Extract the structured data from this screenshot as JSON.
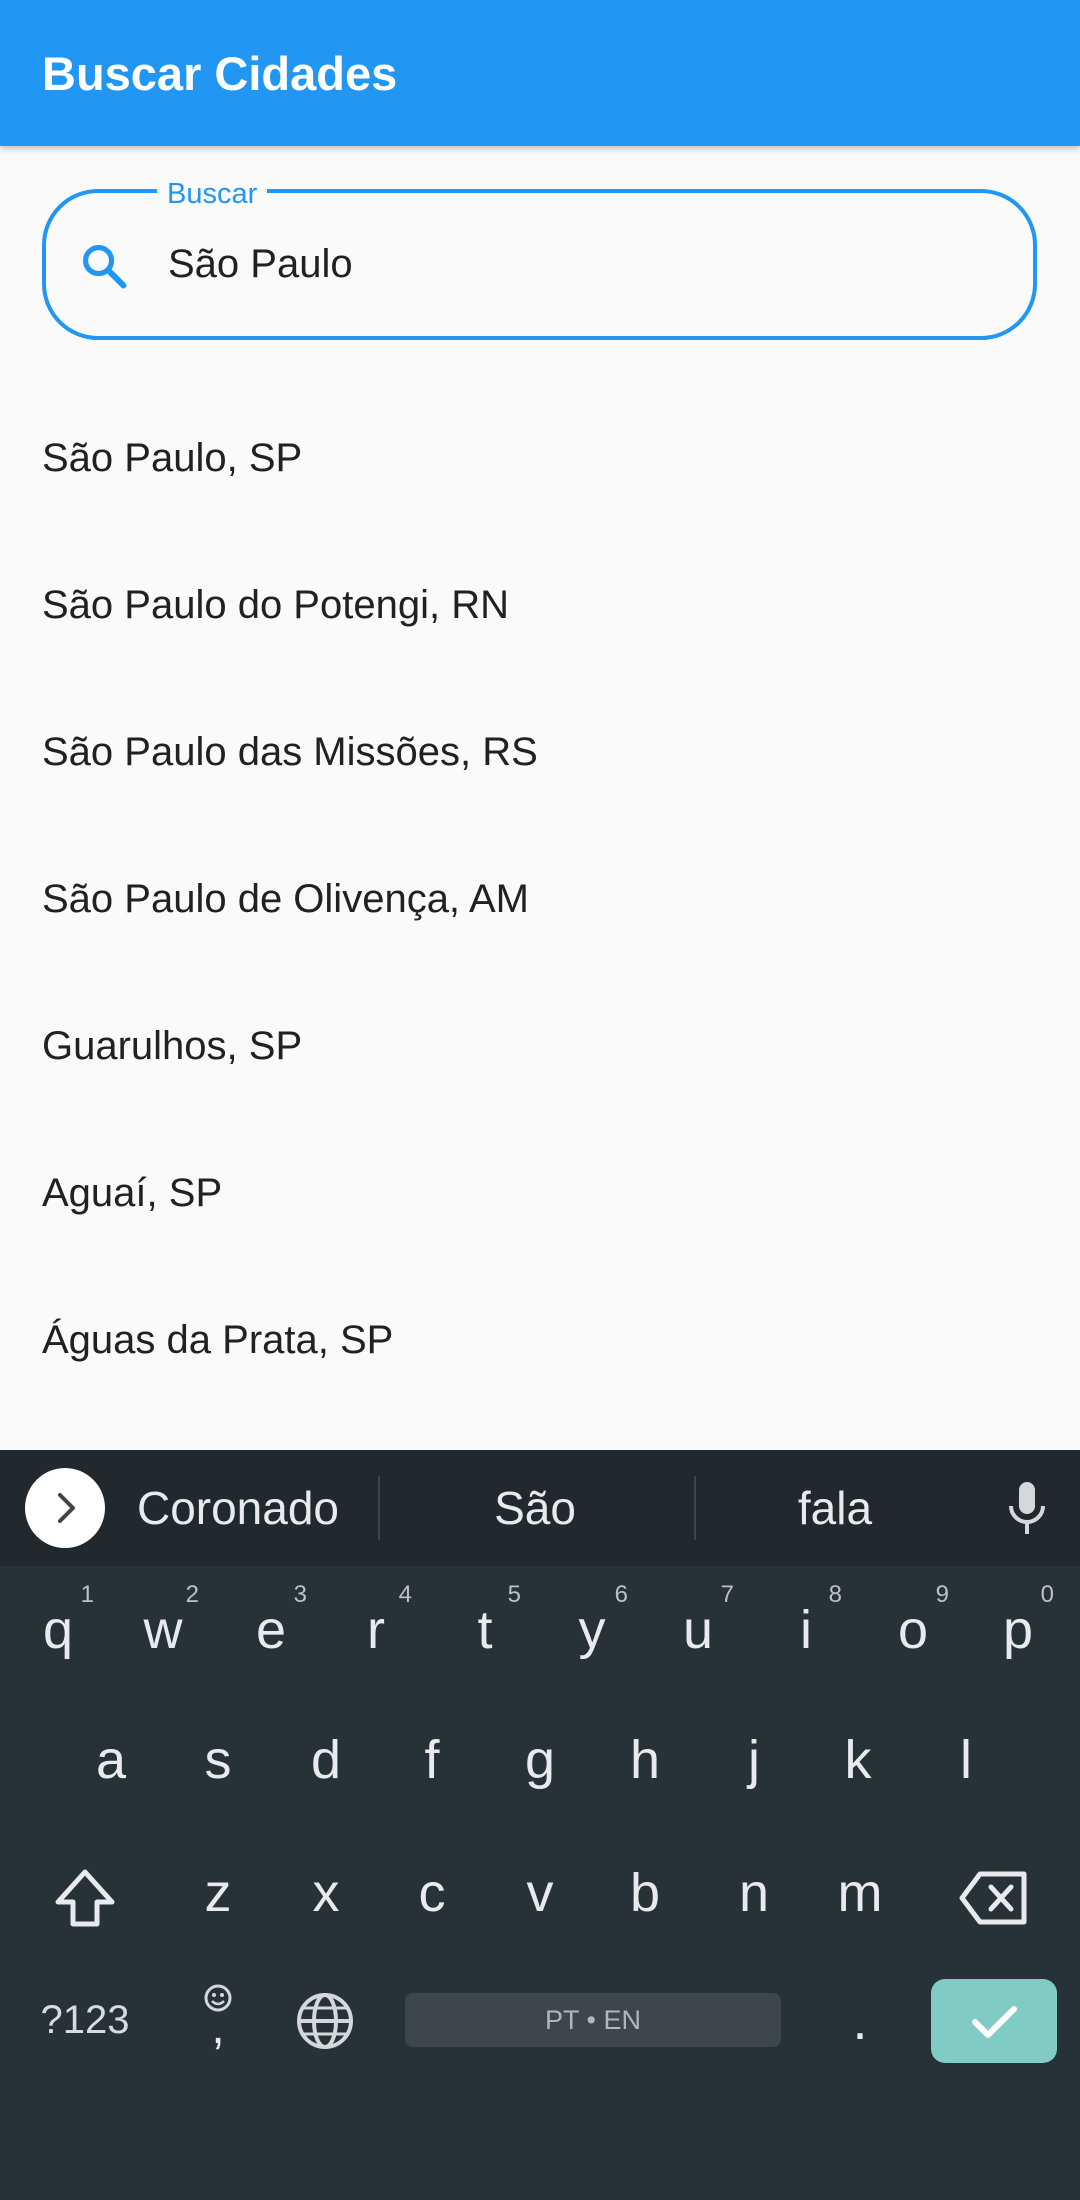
{
  "appbar": {
    "title": "Buscar Cidades",
    "color": "#2196f3"
  },
  "search": {
    "label": "Buscar",
    "value": "São Paulo",
    "icon": "search-icon"
  },
  "results": [
    "São Paulo, SP",
    "São Paulo do Potengi, RN",
    "São Paulo das Missões, RS",
    "São Paulo de Olivença, AM",
    "Guarulhos, SP",
    "Aguaí, SP",
    "Águas da Prata, SP"
  ],
  "keyboard": {
    "suggestions": [
      "Coronado",
      "São",
      "fala"
    ],
    "row1": [
      {
        "k": "q",
        "h": "1"
      },
      {
        "k": "w",
        "h": "2"
      },
      {
        "k": "e",
        "h": "3"
      },
      {
        "k": "r",
        "h": "4"
      },
      {
        "k": "t",
        "h": "5"
      },
      {
        "k": "y",
        "h": "6"
      },
      {
        "k": "u",
        "h": "7"
      },
      {
        "k": "i",
        "h": "8"
      },
      {
        "k": "o",
        "h": "9"
      },
      {
        "k": "p",
        "h": "0"
      }
    ],
    "row2": [
      "a",
      "s",
      "d",
      "f",
      "g",
      "h",
      "j",
      "k",
      "l"
    ],
    "row3": [
      "z",
      "x",
      "c",
      "v",
      "b",
      "n",
      "m"
    ],
    "symbols_label": "?123",
    "emoji_comma": ",",
    "space_label": "PT • EN",
    "period": ".",
    "enter_color": "#80cbc4"
  }
}
